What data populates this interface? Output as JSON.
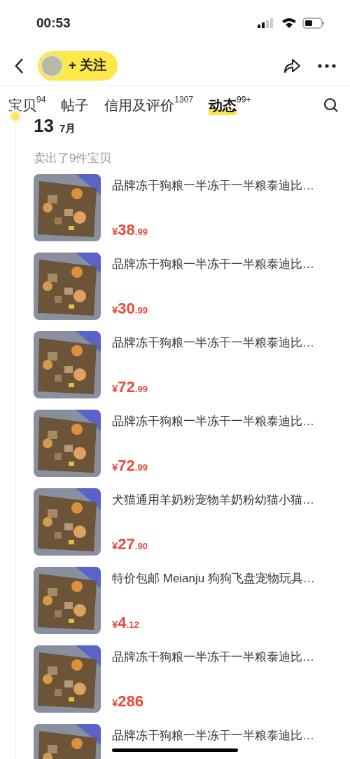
{
  "status_bar": {
    "time": "00:53"
  },
  "header": {
    "follow_label": "+ 关注"
  },
  "tabs": [
    {
      "label": "宝贝",
      "count": "94",
      "selected": false
    },
    {
      "label": "帖子",
      "selected": false
    },
    {
      "label": "信用及评价",
      "count": "1307",
      "selected": false
    },
    {
      "label": "动态",
      "count": "99+",
      "selected": true
    }
  ],
  "timeline": {
    "day": "13",
    "month": "7月",
    "summary": "卖出了9件宝贝"
  },
  "items": [
    {
      "title": "品牌冻干狗粮一半冻干一半粮泰迪比…",
      "currency": "¥",
      "price_main": "38",
      "price_decimal": ".99"
    },
    {
      "title": "品牌冻干狗粮一半冻干一半粮泰迪比…",
      "currency": "¥",
      "price_main": "30",
      "price_decimal": ".99"
    },
    {
      "title": "品牌冻干狗粮一半冻干一半粮泰迪比…",
      "currency": "¥",
      "price_main": "72",
      "price_decimal": ".99"
    },
    {
      "title": "品牌冻干狗粮一半冻干一半粮泰迪比…",
      "currency": "¥",
      "price_main": "72",
      "price_decimal": ".99"
    },
    {
      "title": "犬猫通用羊奶粉宠物羊奶粉幼猫小猫…",
      "currency": "¥",
      "price_main": "27",
      "price_decimal": ".90"
    },
    {
      "title": "特价包邮 Meianju 狗狗飞盘宠物玩具…",
      "currency": "¥",
      "price_main": "4",
      "price_decimal": ".12"
    },
    {
      "title": "品牌冻干狗粮一半冻干一半粮泰迪比…",
      "currency": "¥",
      "price_main": "286"
    },
    {
      "title": "品牌冻干狗粮一半冻干一半粮泰迪比…"
    }
  ]
}
